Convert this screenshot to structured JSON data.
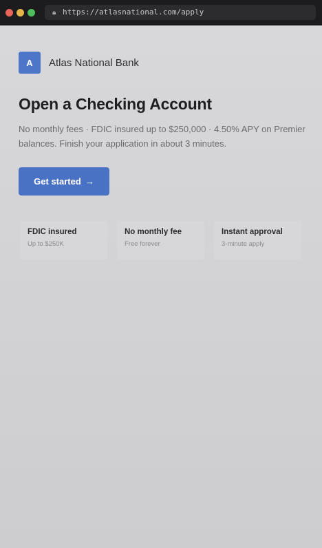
{
  "browser": {
    "url": "https://atlasnational.com/apply",
    "lock_icon": "lock-icon"
  },
  "brand": {
    "logo_letter": "A",
    "name": "Atlas National Bank",
    "logo_color": "#4d76c8"
  },
  "hero": {
    "headline": "Open a Checking Account",
    "subtext": "No monthly fees · FDIC insured up to $250,000 · 4.50% APY on Premier balances. Finish your application in about 3 minutes.",
    "cta_label": "Get started",
    "cta_arrow": "→",
    "cta_color": "#4a72c4"
  },
  "features": [
    {
      "title": "FDIC insured",
      "subtitle": "Up to $250K"
    },
    {
      "title": "No monthly fee",
      "subtitle": "Free forever"
    },
    {
      "title": "Instant approval",
      "subtitle": "3-minute apply"
    }
  ]
}
